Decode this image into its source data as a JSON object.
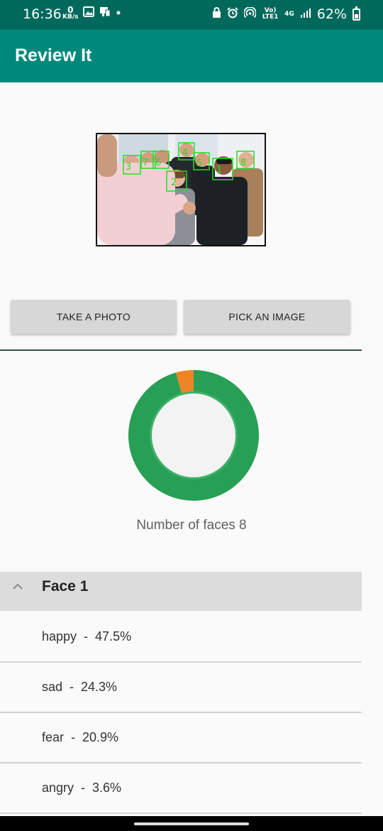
{
  "status_bar": {
    "time": "16:36",
    "net_speed_value": "0",
    "net_speed_unit": "KB/s",
    "lte_label": "Vo) LTE1",
    "network_label": "4G",
    "battery_percent": "62%"
  },
  "app_bar": {
    "title": "Review It"
  },
  "photo": {
    "face_labels": [
      "1",
      "2",
      "3",
      "4",
      "5",
      "6",
      "7",
      "8"
    ],
    "box_color": "#22dd22"
  },
  "buttons": {
    "take_photo": "TAKE A PHOTO",
    "pick_image": "PICK AN IMAGE"
  },
  "chart_data": {
    "type": "pie",
    "style": "donut",
    "series": [
      {
        "value": 95.6,
        "color": "#27a055"
      },
      {
        "value": 4.4,
        "color": "#ef8426"
      }
    ]
  },
  "summary": {
    "faces_count_text": "Number of faces 8"
  },
  "face_panel": {
    "title": "Face 1",
    "emotions": [
      {
        "text": "happy  -  47.5%"
      },
      {
        "text": "sad  -  24.3%"
      },
      {
        "text": "fear  -  20.9%"
      },
      {
        "text": "angry  -  3.6%"
      }
    ]
  },
  "colors": {
    "status_bar": "#00695c",
    "app_bar": "#00897b",
    "accent_green": "#27a055",
    "accent_orange": "#ef8426"
  }
}
